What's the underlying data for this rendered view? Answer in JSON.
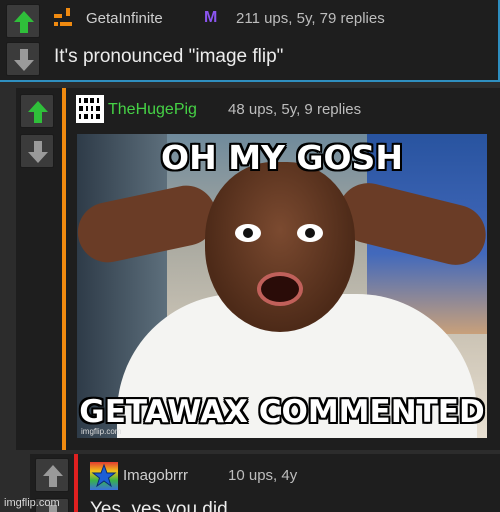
{
  "colors": {
    "upvote_active": "#2fbf3a",
    "downvote": "#9a9a9a",
    "thread_orange": "#f08a10",
    "thread_red": "#e02020",
    "reply_box_border": "#2f8fc0",
    "mod_badge": "#8b55f0",
    "username_green": "#46d246"
  },
  "comments": [
    {
      "username": "GetaInfinite",
      "badge": "M",
      "meta": "211 ups, 5y, 79 replies",
      "text": "It's pronounced \"image flip\"",
      "avatar_icon": "getainfinite-avatar-icon"
    },
    {
      "username": "TheHugePig",
      "meta": "48 ups, 5y, 9 replies",
      "avatar_icon": "binary-avatar-icon",
      "avatar_text": "1001\n0110\n1010",
      "meme": {
        "top_caption": "OH MY GOSH",
        "bottom_caption": "GETAWAX COMMENTED",
        "image_watermark": "imgflip.com"
      }
    },
    {
      "username": "Imagobrrr",
      "meta": "10 ups, 4y",
      "text": "Yes, yes you did",
      "avatar_icon": "star-avatar-icon"
    }
  ],
  "watermark": "imgflip.com"
}
